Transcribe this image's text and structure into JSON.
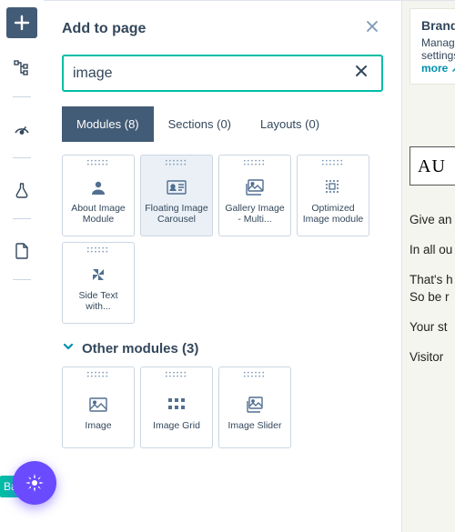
{
  "panel": {
    "title": "Add to page",
    "search_value": "image"
  },
  "tabs": [
    {
      "label": "Modules (8)",
      "active": true
    },
    {
      "label": "Sections (0)",
      "active": false
    },
    {
      "label": "Layouts (0)",
      "active": false
    }
  ],
  "theme_modules": [
    {
      "label": "About Image Module",
      "icon": "person"
    },
    {
      "label": "Floating Image Carousel",
      "icon": "id-card",
      "selected": true
    },
    {
      "label": "Gallery Image - Multi...",
      "icon": "gallery"
    },
    {
      "label": "Optimized Image module",
      "icon": "dots-square"
    },
    {
      "label": "Side Text with...",
      "icon": "pinwheel"
    }
  ],
  "other_section": {
    "title": "Other modules (3)"
  },
  "other_modules": [
    {
      "label": "Image",
      "icon": "image"
    },
    {
      "label": "Image Grid",
      "icon": "grid"
    },
    {
      "label": "Image Slider",
      "icon": "image-stack"
    }
  ],
  "right": {
    "brand_title": "Brand",
    "brand_sub": "Manage settings",
    "brand_more": "more",
    "au": "AU",
    "lines": [
      "Give an",
      "In all ou",
      "That's h",
      "So be r",
      "Your st",
      "Visitor"
    ]
  },
  "fab_back": "Ba"
}
